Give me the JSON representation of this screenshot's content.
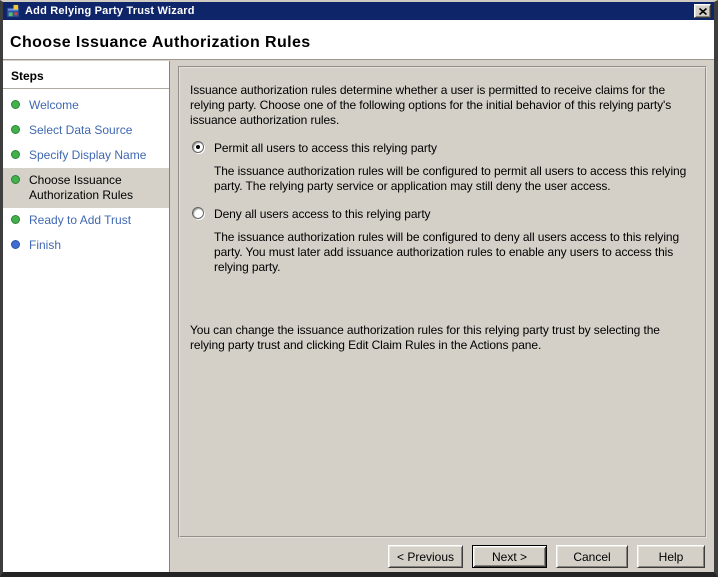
{
  "window": {
    "title": "Add Relying Party Trust Wizard"
  },
  "page": {
    "heading": "Choose Issuance Authorization Rules"
  },
  "sidebar": {
    "title": "Steps",
    "items": [
      {
        "label": "Welcome",
        "state": "done"
      },
      {
        "label": "Select Data Source",
        "state": "done"
      },
      {
        "label": "Specify Display Name",
        "state": "done"
      },
      {
        "label": "Choose Issuance Authorization Rules",
        "state": "current"
      },
      {
        "label": "Ready to Add Trust",
        "state": "done"
      },
      {
        "label": "Finish",
        "state": "final"
      }
    ]
  },
  "content": {
    "intro": "Issuance authorization rules determine whether a user is permitted to receive claims for the relying party. Choose one of the following options for the initial behavior of this relying party's issuance authorization rules.",
    "options": [
      {
        "label": "Permit all users to access this relying party",
        "description": "The issuance authorization rules will be configured to permit all users to access this relying party. The relying party service or application may still deny the user access.",
        "selected": true
      },
      {
        "label": "Deny all users access to this relying party",
        "description": "The issuance authorization rules will be configured to deny all users access to this relying party. You must later add issuance authorization rules to enable any users to access this relying party.",
        "selected": false
      }
    ],
    "footnote": "You can change the issuance authorization rules for this relying party trust by selecting the relying party trust and clicking Edit Claim Rules in the Actions pane."
  },
  "buttons": {
    "previous": "< Previous",
    "next": "Next >",
    "cancel": "Cancel",
    "help": "Help"
  },
  "colors": {
    "titlebar": "#0f2569",
    "dialog_bg": "#d4d0c8",
    "sidebar_bg": "#ffffff",
    "step_link": "#4068b0",
    "step_current_bg": "#d5d1c9",
    "bullet_done": "#43b14b",
    "bullet_final": "#3e6ed2"
  }
}
